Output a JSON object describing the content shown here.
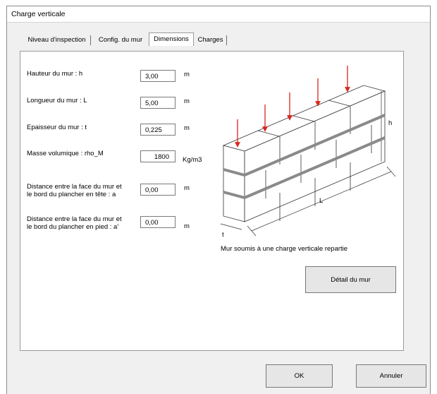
{
  "window": {
    "title": "Charge verticale"
  },
  "tabs": [
    {
      "label": "Niveau d'inspection",
      "active": false
    },
    {
      "label": "Config. du mur",
      "active": false
    },
    {
      "label": "Dimensions",
      "active": true
    },
    {
      "label": "Charges",
      "active": false
    }
  ],
  "form": {
    "hauteur": {
      "label": "Hauteur du mur : h",
      "value": "3,00",
      "unit": "m"
    },
    "longueur": {
      "label": "Longueur du mur : L",
      "value": "5,00",
      "unit": "m"
    },
    "epaisseur": {
      "label": "Epaisseur du mur : t",
      "value": "0,225",
      "unit": "m"
    },
    "masse": {
      "label": "Masse volumique : rho_M",
      "value": "1800",
      "unit": "Kg/m3"
    },
    "dist_tete": {
      "label_line1": "Distance entre la face du mur et",
      "label_line2": "le bord du plancher en tête : a",
      "value": "0,00",
      "unit": "m"
    },
    "dist_pied": {
      "label_line1": "Distance entre la face du mur et",
      "label_line2": "le bord du plancher en pied : a'",
      "value": "0,00",
      "unit": "m"
    }
  },
  "illustration": {
    "labels": {
      "h": "h",
      "L": "L",
      "t": "t"
    },
    "caption": "Mur soumis à une charge verticale repartie",
    "arrow_color": "#d9261c",
    "band_color": "#8a8a8a"
  },
  "buttons": {
    "detail": "Détail du mur",
    "ok": "OK",
    "cancel": "Annuler"
  }
}
